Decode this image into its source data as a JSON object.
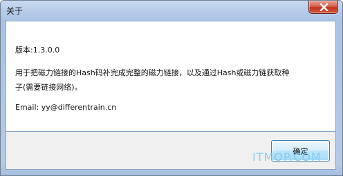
{
  "window": {
    "title": "关于",
    "close_icon": "close-x-icon"
  },
  "content": {
    "version": "版本:1.3.0.0",
    "description_line1": "用于把磁力链接的Hash码补完成完整的磁力链接，以及通过Hash或磁力链获取种",
    "description_line2": "子(需要链接网络)。",
    "email": "Email: yy@differentrain.cn"
  },
  "footer": {
    "ok_label": "确定"
  },
  "watermark": {
    "text": "ITMOP.COM"
  },
  "colors": {
    "title_bar": "#b7cde8",
    "close_button": "#c1331d",
    "button_border": "#3c7fb1",
    "footer_bg": "#f0f0f0",
    "watermark": "#7cc9ee"
  }
}
